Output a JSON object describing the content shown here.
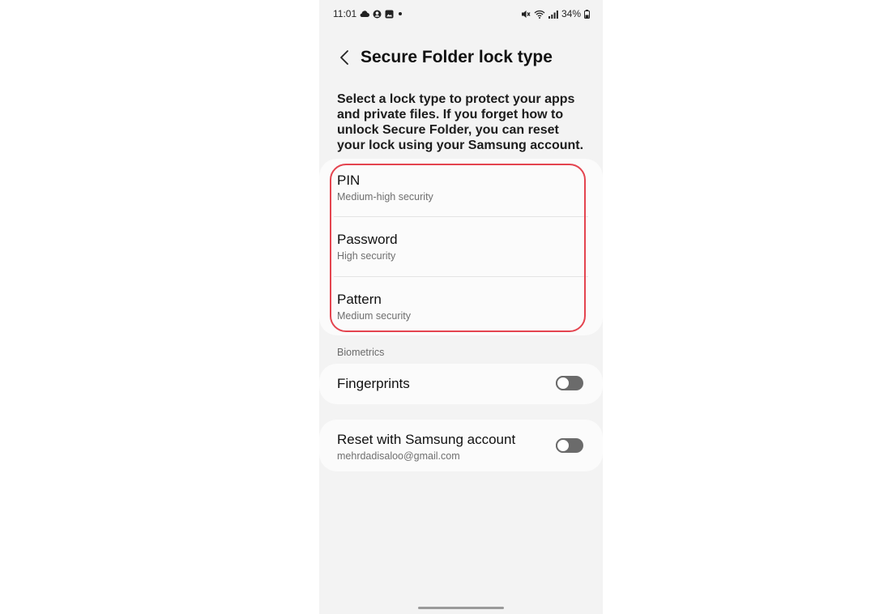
{
  "status_bar": {
    "time": "11:01",
    "battery": "34%",
    "left_icons": [
      "cloud-icon",
      "account-icon",
      "gallery-icon",
      "dot-icon"
    ],
    "right_icons": [
      "mute-icon",
      "wifi-icon",
      "signal-icon",
      "battery-icon"
    ]
  },
  "header": {
    "title": "Secure Folder lock type"
  },
  "description": "Select a lock type to protect your apps and private files. If you forget how to unlock Secure Folder, you can reset your lock using your Samsung account.",
  "lock_options": [
    {
      "title": "PIN",
      "subtitle": "Medium-high security"
    },
    {
      "title": "Password",
      "subtitle": "High security"
    },
    {
      "title": "Pattern",
      "subtitle": "Medium security"
    }
  ],
  "biometrics": {
    "section_label": "Biometrics",
    "fingerprints_label": "Fingerprints",
    "fingerprints_enabled": false
  },
  "reset": {
    "title": "Reset with Samsung account",
    "subtitle": "mehrdadisaloo@gmail.com",
    "enabled": false
  },
  "colors": {
    "highlight": "#e4444f",
    "toggle_off": "#6b6b6b",
    "background": "#f3f3f3",
    "card": "#fbfbfb"
  }
}
